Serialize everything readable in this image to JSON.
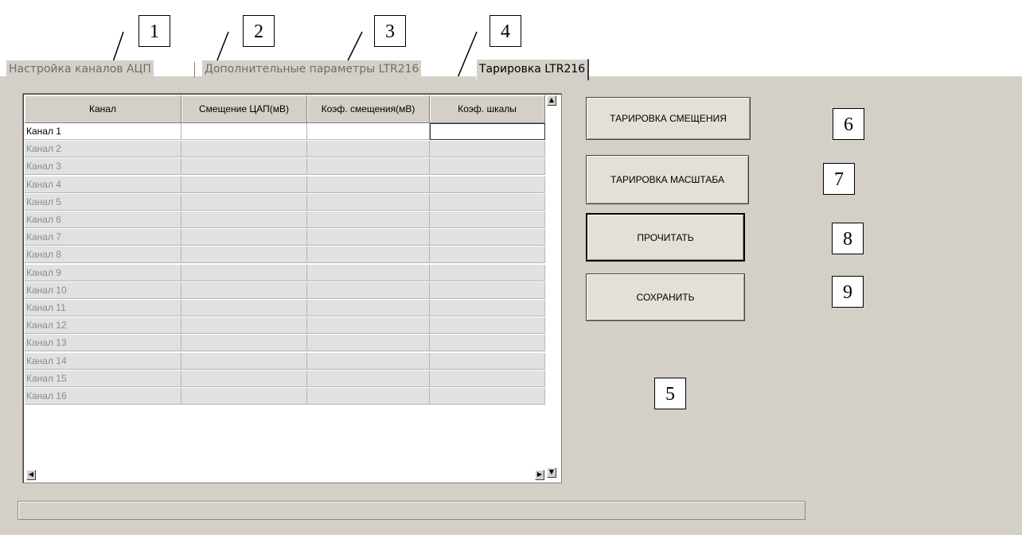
{
  "tabs": [
    {
      "label": "Настройка каналов АЦП",
      "active": false
    },
    {
      "label": "Дополнительные параметры LTR216",
      "active": false
    },
    {
      "label": "Тарировка LTR216",
      "active": true
    }
  ],
  "table": {
    "columns": [
      "Канал",
      "Смещение ЦАП(мВ)",
      "Коэф. смещения(мВ)",
      "Коэф. шкалы"
    ],
    "rows": [
      {
        "channel": "Канал 1",
        "offset": "",
        "offset_coef": "",
        "scale_coef": ""
      },
      {
        "channel": "Канал 2",
        "offset": "",
        "offset_coef": "",
        "scale_coef": ""
      },
      {
        "channel": "Канал 3",
        "offset": "",
        "offset_coef": "",
        "scale_coef": ""
      },
      {
        "channel": "Канал 4",
        "offset": "",
        "offset_coef": "",
        "scale_coef": ""
      },
      {
        "channel": "Канал 5",
        "offset": "",
        "offset_coef": "",
        "scale_coef": ""
      },
      {
        "channel": "Канал 6",
        "offset": "",
        "offset_coef": "",
        "scale_coef": ""
      },
      {
        "channel": "Канал 7",
        "offset": "",
        "offset_coef": "",
        "scale_coef": ""
      },
      {
        "channel": "Канал 8",
        "offset": "",
        "offset_coef": "",
        "scale_coef": ""
      },
      {
        "channel": "Канал 9",
        "offset": "",
        "offset_coef": "",
        "scale_coef": ""
      },
      {
        "channel": "Канал 10",
        "offset": "",
        "offset_coef": "",
        "scale_coef": ""
      },
      {
        "channel": "Канал 11",
        "offset": "",
        "offset_coef": "",
        "scale_coef": ""
      },
      {
        "channel": "Канал 12",
        "offset": "",
        "offset_coef": "",
        "scale_coef": ""
      },
      {
        "channel": "Канал 13",
        "offset": "",
        "offset_coef": "",
        "scale_coef": ""
      },
      {
        "channel": "Канал 14",
        "offset": "",
        "offset_coef": "",
        "scale_coef": ""
      },
      {
        "channel": "Канал 15",
        "offset": "",
        "offset_coef": "",
        "scale_coef": ""
      },
      {
        "channel": "Канал 16",
        "offset": "",
        "offset_coef": "",
        "scale_coef": ""
      }
    ]
  },
  "buttons": {
    "calibrate_offset": "ТАРИРОВКА СМЕЩЕНИЯ",
    "calibrate_scale": "ТАРИРОВКА МАСШТАБА",
    "read": "ПРОЧИТАТЬ",
    "save": "СОХРАНИТЬ"
  },
  "status_text": "",
  "callouts": [
    "1",
    "2",
    "3",
    "4",
    "5",
    "6",
    "7",
    "8",
    "9"
  ]
}
